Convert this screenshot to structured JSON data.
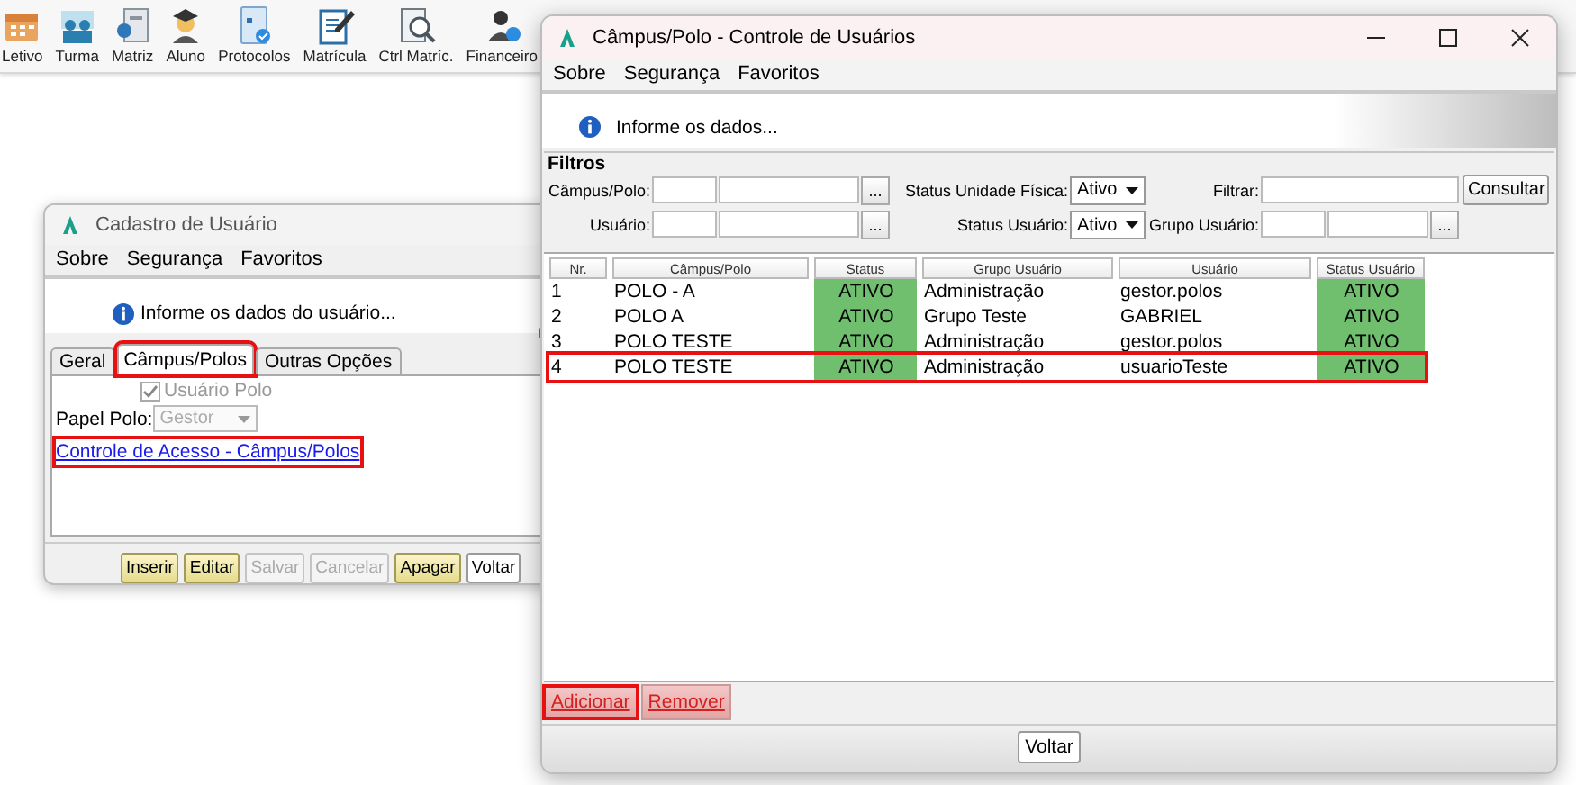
{
  "toolbar": [
    {
      "label": "Letivo"
    },
    {
      "label": "Turma"
    },
    {
      "label": "Matriz"
    },
    {
      "label": "Aluno"
    },
    {
      "label": "Protocolos"
    },
    {
      "label": "Matrícula"
    },
    {
      "label": "Ctrl Matríc."
    },
    {
      "label": "Financeiro"
    }
  ],
  "user_window": {
    "title": "Cadastro de Usuário",
    "menu": [
      "Sobre",
      "Segurança",
      "Favoritos"
    ],
    "info": "Informe os dados do usuário...",
    "tabs": [
      {
        "label": "Geral",
        "selected": false,
        "highlighted": false
      },
      {
        "label": "Câmpus/Polos",
        "selected": true,
        "highlighted": true
      },
      {
        "label": "Outras Opções",
        "selected": false,
        "highlighted": false
      }
    ],
    "checkbox": {
      "label": "Usuário Polo",
      "checked": true,
      "disabled": true
    },
    "role": {
      "label": "Papel Polo:",
      "value": "Gestor",
      "disabled": true
    },
    "link": {
      "text": "Controle de Acesso - Câmpus/Polos",
      "highlighted": true
    },
    "buttons": [
      {
        "label": "Inserir",
        "disabled": false,
        "kind": "action"
      },
      {
        "label": "Editar",
        "disabled": false,
        "kind": "action"
      },
      {
        "label": "Salvar",
        "disabled": true,
        "kind": "action"
      },
      {
        "label": "Cancelar",
        "disabled": true,
        "kind": "action"
      },
      {
        "label": "Apagar",
        "disabled": false,
        "kind": "action"
      },
      {
        "label": "Voltar",
        "disabled": false,
        "kind": "plain"
      }
    ]
  },
  "polo_window": {
    "title": "Câmpus/Polo - Controle de Usuários",
    "menu": [
      "Sobre",
      "Segurança",
      "Favoritos"
    ],
    "info": "Informe os dados...",
    "filters": {
      "title": "Filtros",
      "campus": {
        "label": "Câmpus/Polo:",
        "lookup": "..."
      },
      "status_unidade": {
        "label": "Status Unidade Física:",
        "value": "Ativo"
      },
      "filtrar": {
        "label": "Filtrar:",
        "button": "Consultar"
      },
      "usuario": {
        "label": "Usuário:",
        "lookup": "..."
      },
      "status_usuario": {
        "label": "Status Usuário:",
        "value": "Ativo"
      },
      "grupo": {
        "label": "Grupo Usuário:",
        "lookup": "..."
      }
    },
    "table": {
      "columns": [
        "Nr.",
        "Câmpus/Polo",
        "Status",
        "Grupo Usuário",
        "Usuário",
        "Status Usuário"
      ],
      "rows": [
        {
          "cells": [
            "1",
            "POLO - A",
            "ATIVO",
            "Administração",
            "gestor.polos",
            "ATIVO"
          ],
          "highlighted": false
        },
        {
          "cells": [
            "2",
            "POLO A",
            "ATIVO",
            "Grupo Teste",
            "GABRIEL",
            "ATIVO"
          ],
          "highlighted": false
        },
        {
          "cells": [
            "3",
            "POLO TESTE",
            "ATIVO",
            "Administração",
            "gestor.polos",
            "ATIVO"
          ],
          "highlighted": false
        },
        {
          "cells": [
            "4",
            "POLO TESTE",
            "ATIVO",
            "Administração",
            "usuarioTeste",
            "ATIVO"
          ],
          "highlighted": true
        }
      ]
    },
    "actions": [
      {
        "label": "Adicionar",
        "highlighted": true
      },
      {
        "label": "Remover",
        "highlighted": false
      }
    ],
    "footer_button": "Voltar"
  }
}
